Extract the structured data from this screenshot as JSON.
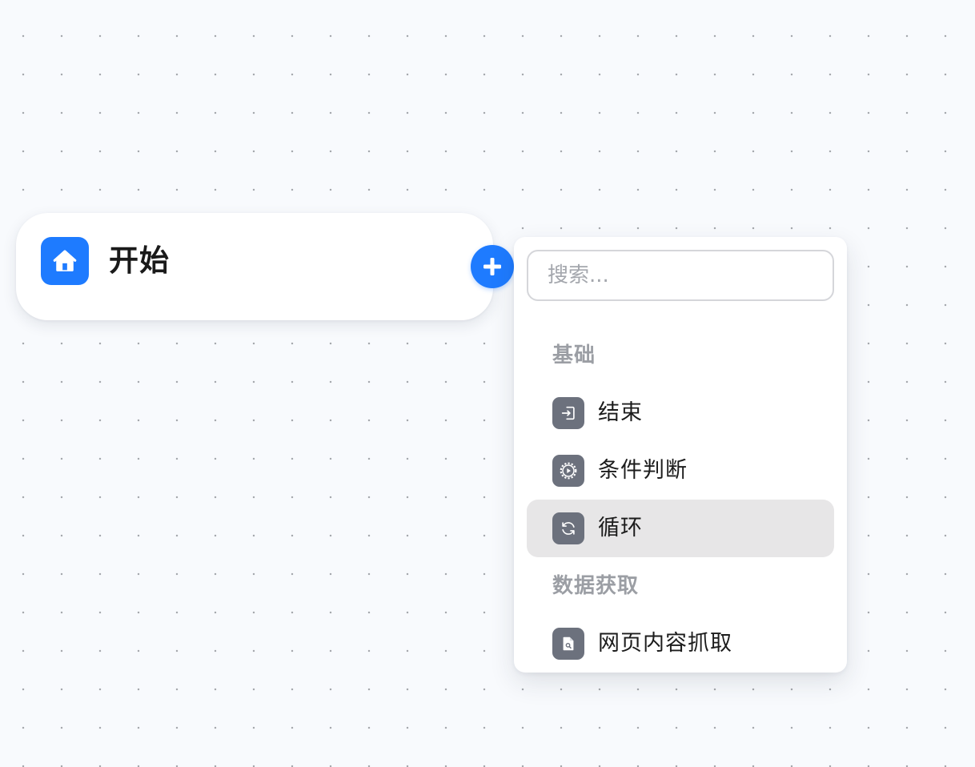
{
  "start_node": {
    "title": "开始",
    "icon": "home-icon"
  },
  "add_button": {
    "icon": "plus-icon"
  },
  "dropdown": {
    "search": {
      "placeholder": "搜索...",
      "value": ""
    },
    "sections": [
      {
        "label": "基础",
        "items": [
          {
            "label": "结束",
            "icon": "exit-icon"
          },
          {
            "label": "条件判断",
            "icon": "gear-play-icon"
          },
          {
            "label": "循环",
            "icon": "refresh-icon",
            "active": true
          }
        ]
      },
      {
        "label": "数据获取",
        "items": [
          {
            "label": "网页内容抓取",
            "icon": "file-search-icon"
          }
        ]
      }
    ]
  },
  "colors": {
    "accent": "#1e7bff",
    "icon_bg": "#6c717d",
    "active_item_bg": "#e7e6e7",
    "canvas_bg": "#f8fafd"
  }
}
